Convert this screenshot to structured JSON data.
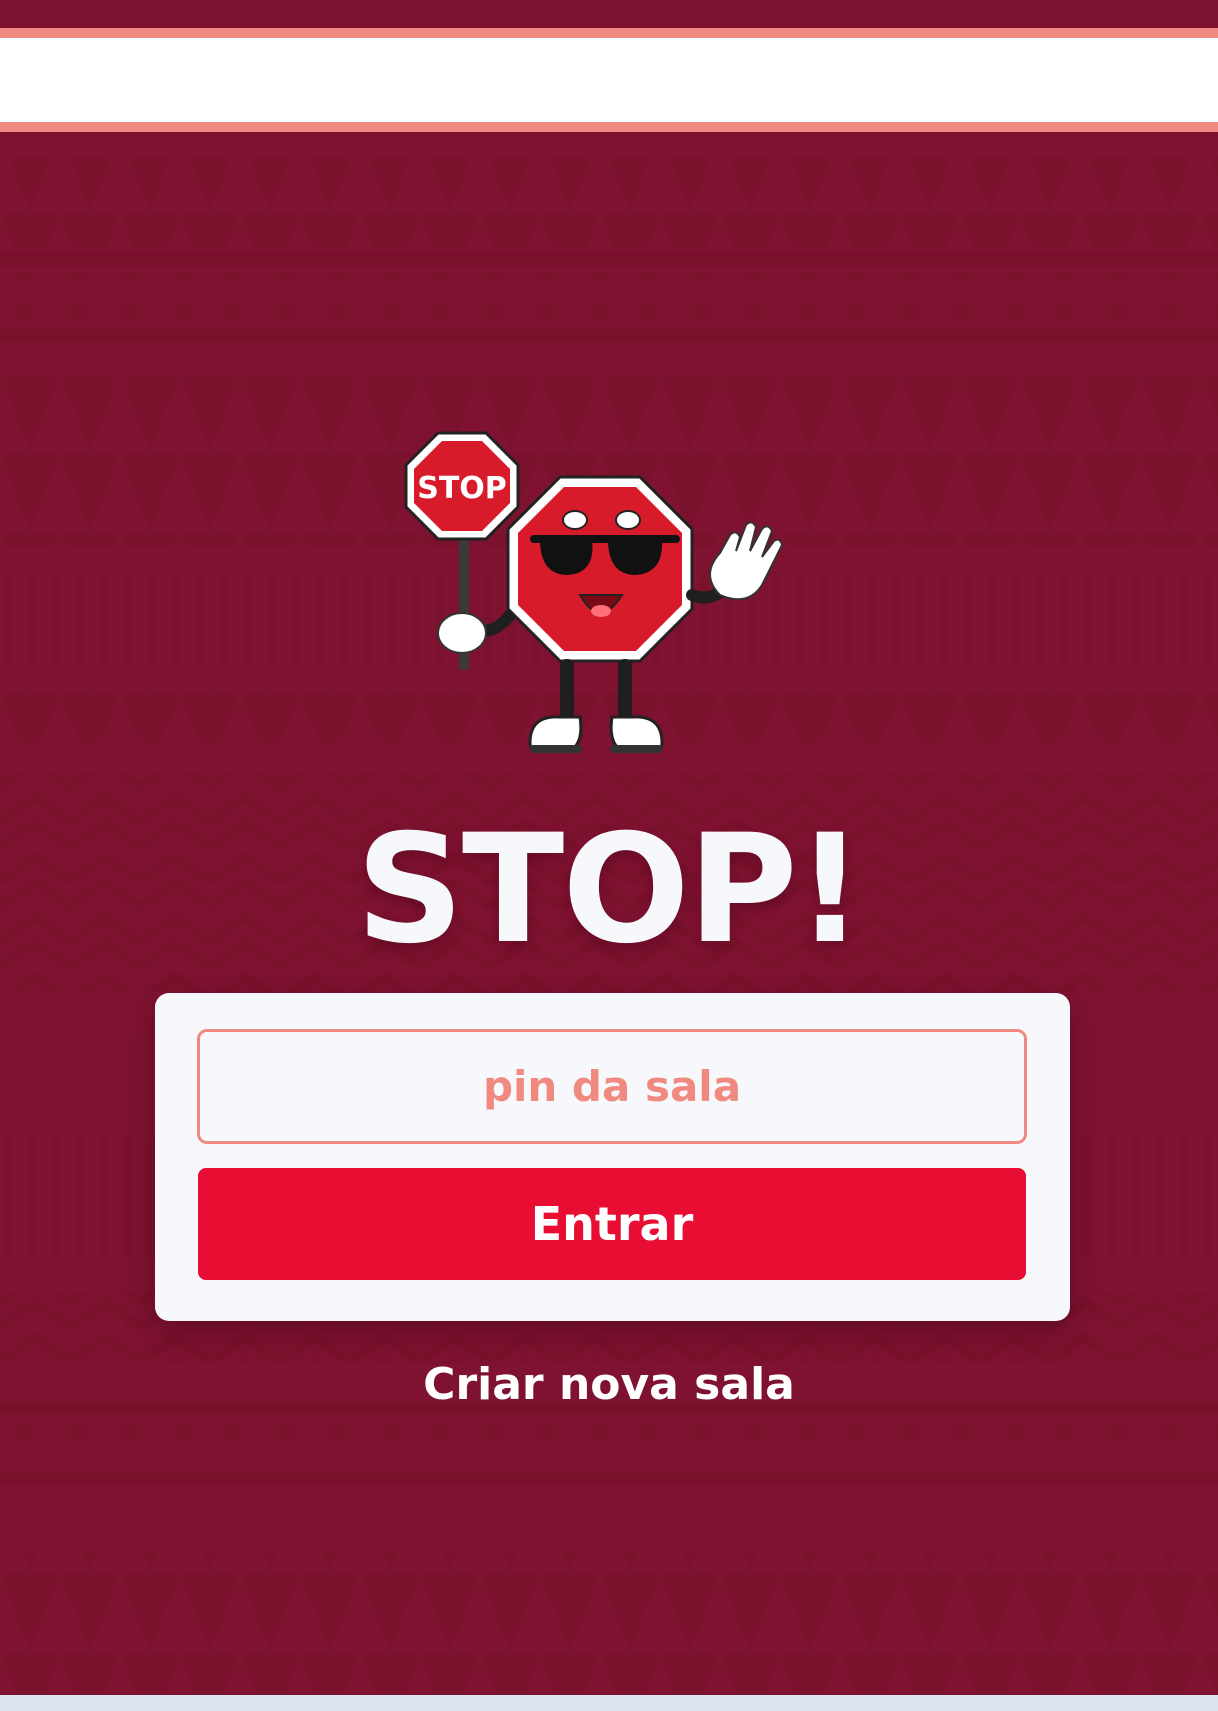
{
  "app": {
    "title": "STOP!"
  },
  "join_form": {
    "pin_placeholder": "pin da sala",
    "pin_value": "",
    "enter_label": "Entrar"
  },
  "create_room": {
    "label": "Criar nova sala"
  },
  "mascot": {
    "sign_text": "STOP"
  },
  "colors": {
    "background": "#7f1231",
    "header_border": "#f08a80",
    "card": "#f7f8fb",
    "accent_red": "#e90c33",
    "placeholder": "#f08a80"
  }
}
